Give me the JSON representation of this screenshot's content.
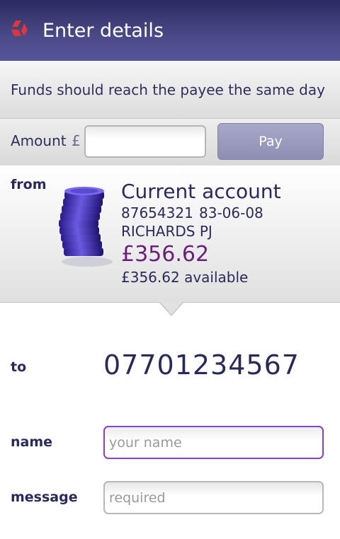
{
  "header": {
    "title": "Enter details",
    "logo_icon": "bank-logo-icon"
  },
  "notice": {
    "text": "Funds should reach the payee the same day"
  },
  "amount": {
    "label": "Amount",
    "currency_symbol": "£",
    "value": "",
    "pay_label": "Pay"
  },
  "from": {
    "label": "from",
    "account_name": "Current account",
    "account_number": "87654321",
    "sort_code": "83-06-08",
    "holder": "RICHARDS PJ",
    "balance": "£356.62",
    "available": "£356.62 available",
    "icon": "coin-stack-icon"
  },
  "to": {
    "label": "to",
    "number": "07701234567"
  },
  "name": {
    "label": "name",
    "placeholder": "your name",
    "value": ""
  },
  "message": {
    "label": "message",
    "placeholder": "required",
    "value": ""
  },
  "colors": {
    "header": "#3b3b76",
    "balance": "#6a1f7a",
    "focus_border": "#8a3fd0",
    "pay_button": "#9a9abd"
  }
}
